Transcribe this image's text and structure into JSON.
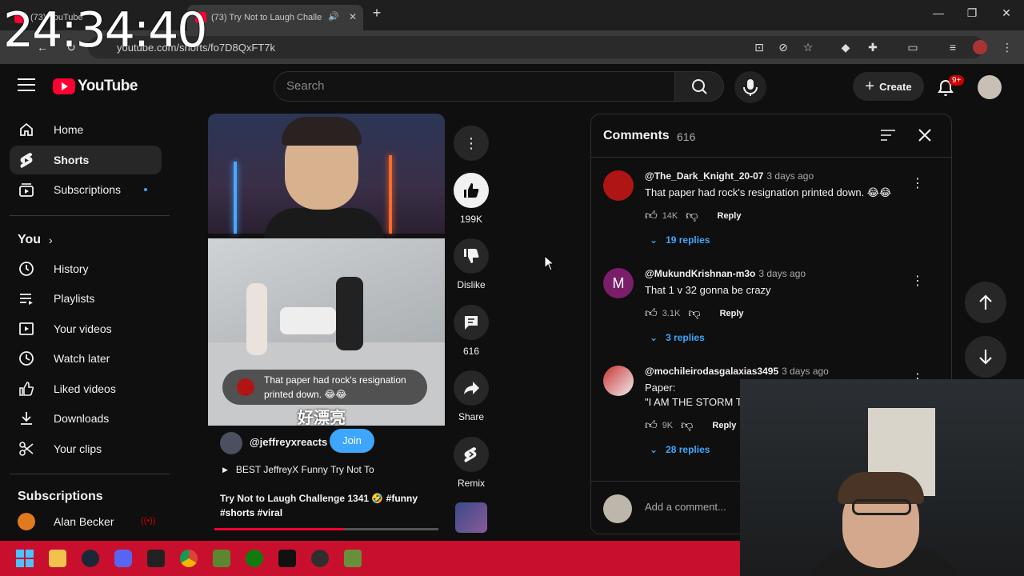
{
  "clock": "24:34:40",
  "browser": {
    "tabs": [
      {
        "label": "(73) YouTube"
      },
      {
        "label": "(73) Try Not to Laugh Challe"
      }
    ],
    "url": "youtube.com/shorts/fo7D8QxFT7k"
  },
  "header": {
    "logo_text": "YouTube",
    "search_placeholder": "Search",
    "create_label": "Create",
    "notif_badge": "9+"
  },
  "sidebar": {
    "main": [
      {
        "label": "Home",
        "icon": "home-icon"
      },
      {
        "label": "Shorts",
        "icon": "shorts-icon"
      },
      {
        "label": "Subscriptions",
        "icon": "subscriptions-icon"
      }
    ],
    "you_heading": "You",
    "you_items": [
      {
        "label": "History",
        "icon": "history-icon"
      },
      {
        "label": "Playlists",
        "icon": "playlists-icon"
      },
      {
        "label": "Your videos",
        "icon": "your-videos-icon"
      },
      {
        "label": "Watch later",
        "icon": "watch-later-icon"
      },
      {
        "label": "Liked videos",
        "icon": "liked-videos-icon"
      },
      {
        "label": "Downloads",
        "icon": "downloads-icon"
      },
      {
        "label": "Your clips",
        "icon": "clips-icon"
      }
    ],
    "subs_heading": "Subscriptions",
    "subs": [
      {
        "label": "Alan Becker"
      }
    ]
  },
  "short": {
    "overlay_comment": "That paper had rock's resignation printed down. 😂😂",
    "subtitle": "好漂亮",
    "channel": "@jeffreyxreacts",
    "join_label": "Join",
    "playlist": "BEST JeffreyX Funny Try Not To",
    "title": "Try Not to Laugh Challenge 1341 🤣",
    "hashtags": "#funny #shorts #viral",
    "progress": 0.58
  },
  "actions": {
    "likes": "199K",
    "dislike_label": "Dislike",
    "comments_count": "616",
    "share_label": "Share",
    "remix_label": "Remix"
  },
  "comments": {
    "title": "Comments",
    "count": "616",
    "items": [
      {
        "author": "@The_Dark_Knight_20-07",
        "time": "3 days ago",
        "text": "That paper had rock's resignation printed down. 😂😂",
        "likes": "14K",
        "reply": "Reply",
        "replies": "19 replies"
      },
      {
        "author": "@MukundKrishnan-m3o",
        "time": "3 days ago",
        "text": "That 1 v 32 gonna be crazy",
        "likes": "3.1K",
        "reply": "Reply",
        "replies": "3 replies"
      },
      {
        "author": "@mochileirodasgalaxias3495",
        "time": "3 days ago",
        "text_line1": "Paper:",
        "text_line2": "\"I AM THE STORM TI",
        "likes": "9K",
        "reply": "Reply",
        "replies": "28 replies"
      }
    ],
    "add_placeholder": "Add a comment..."
  },
  "colors": {
    "accent_red": "#ff0033",
    "link_blue": "#3ea6ff",
    "taskbar": "#c8102e"
  }
}
